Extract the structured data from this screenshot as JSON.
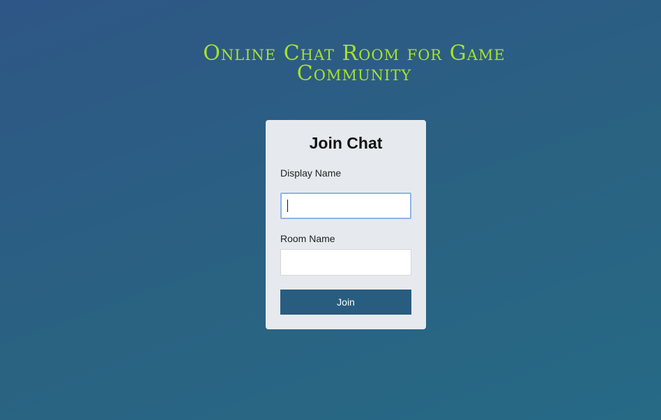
{
  "page": {
    "title": "Online Chat Room for Game Community"
  },
  "form": {
    "title": "Join Chat",
    "display_name": {
      "label": "Display Name",
      "value": "",
      "placeholder": ""
    },
    "room_name": {
      "label": "Room Name",
      "value": "",
      "placeholder": ""
    },
    "submit_label": "Join"
  },
  "colors": {
    "background": "#2b5c84",
    "title": "#a6e22e",
    "card": "#e6eaee",
    "button": "#285d7f",
    "focus_border": "#8fb4e6"
  }
}
